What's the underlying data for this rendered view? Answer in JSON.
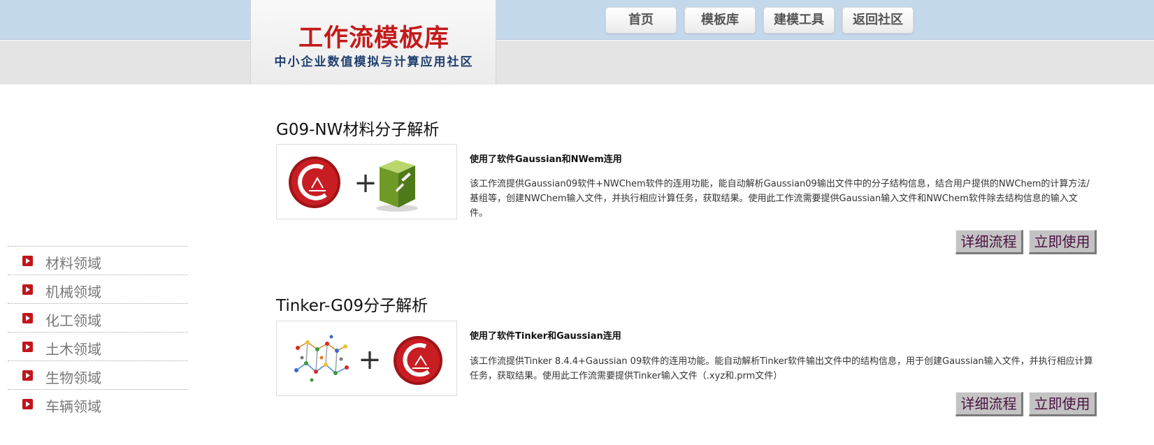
{
  "header": {
    "logo_title": "工作流模板库",
    "logo_subtitle": "中小企业数值模拟与计算应用社区",
    "nav": [
      "首页",
      "模板库",
      "建模工具",
      "返回社区"
    ]
  },
  "sidebar": {
    "items": [
      {
        "label": "材料领域",
        "icon": "red-play-arrow-icon"
      },
      {
        "label": "机械领域",
        "icon": "red-play-arrow-icon"
      },
      {
        "label": "化工领域",
        "icon": "red-play-arrow-icon"
      },
      {
        "label": "土木领域",
        "icon": "red-play-arrow-icon"
      },
      {
        "label": "生物领域",
        "icon": "red-play-arrow-icon"
      },
      {
        "label": "车辆领域",
        "icon": "red-play-arrow-icon"
      }
    ]
  },
  "workflows": [
    {
      "title": "G09-NW材料分子解析",
      "uses": "使用了软件Gaussian和NWem连用",
      "description": "该工作流提供Gaussian09软件+NWChem软件的连用功能，能自动解析Gaussian09输出文件中的分子结构信息，结合用户提供的NWChem的计算方法/基组等，创建NWChem输入文件，并执行相应计算任务，获取结果。使用此工作流需要提供Gaussian输入文件和NWChem软件除去结构信息的输入文件。",
      "detail_button": "详细流程",
      "use_button": "立即使用",
      "thumb_plus": "+",
      "thumb_icons": [
        "gaussian-logo-icon",
        "nwchem-cube-icon"
      ]
    },
    {
      "title": "Tinker-G09分子解析",
      "uses": "使用了软件Tinker和Gaussian连用",
      "description": "该工作流提供Tinker 8.4.4+Gaussian 09软件的连用功能。能自动解析Tinker软件输出文件中的结构信息，用于创建Gaussian输入文件，并执行相应计算任务，获取结果。使用此工作流需要提供Tinker输入文件（.xyz和.prm文件）",
      "detail_button": "详细流程",
      "use_button": "立即使用",
      "thumb_plus": "+",
      "thumb_icons": [
        "tinker-molecule-icon",
        "gaussian-logo-icon"
      ]
    }
  ],
  "colors": {
    "header_blue": "#c4d8ec",
    "logo_red": "#c41a1a",
    "logo_navy": "#1f3f6e",
    "button_text": "#4a1040"
  }
}
